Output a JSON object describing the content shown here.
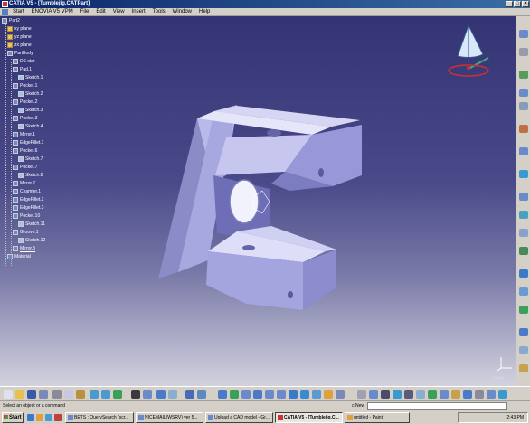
{
  "window": {
    "title": "CATIA V5 - [Tumblejig.CATPart]"
  },
  "menu": [
    "Start",
    "ENOVIA V5 VPM",
    "File",
    "Edit",
    "View",
    "Insert",
    "Tools",
    "Window",
    "Help"
  ],
  "tree": {
    "root": "Part2",
    "items": [
      "xy plane",
      "yz plane",
      "zx plane",
      "PartBody",
      "DS star",
      "Pad.1",
      "Sketch.1",
      "Pocket.1",
      "Sketch.2",
      "Pocket.2",
      "Sketch.3",
      "Pocket.3",
      "Sketch.4",
      "Mirror.1",
      "EdgeFillet.1",
      "Pocket.6",
      "Sketch.7",
      "Pocket.7",
      "Sketch.8",
      "Mirror.2",
      "Chamfer.1",
      "EdgeFillet.2",
      "EdgeFillet.3",
      "Pocket.10",
      "Sketch.11",
      "Groove.1",
      "Sketch.12",
      "Mirror.3",
      "Material"
    ]
  },
  "status": {
    "prompt": "Select an object or a command",
    "command_label": "c:New"
  },
  "compass_label": "CATIA",
  "taskbar": {
    "start": "Start",
    "tasks": [
      "BETS : QuerySearch (scr...",
      "NICEMAIL(WSRV) ver 5...",
      "Upload a CAD model - Gr...",
      "CATIA V5 - [Tumblejig.C...",
      "untitled - Paint"
    ],
    "clock": "2:43 PM"
  }
}
